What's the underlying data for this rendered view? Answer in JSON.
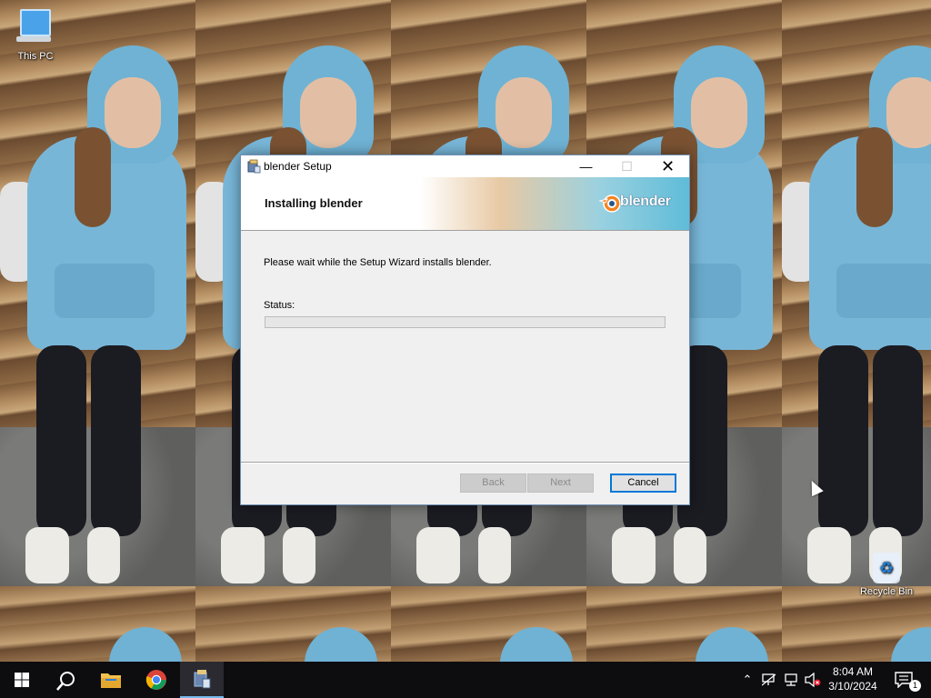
{
  "desktop": {
    "icons": [
      {
        "label": "This PC",
        "icon": "computer-icon"
      },
      {
        "label": "Recycle Bin",
        "icon": "recycle-bin-icon"
      }
    ]
  },
  "window": {
    "title": "blender Setup",
    "banner_title": "Installing blender",
    "logo_text": "blender",
    "wait_text": "Please wait while the Setup Wizard installs blender.",
    "status_label": "Status:",
    "progress_percent": 0,
    "buttons": {
      "back": "Back",
      "next": "Next",
      "cancel": "Cancel"
    },
    "controls": {
      "minimize": "minimize-icon",
      "maximize": "maximize-icon",
      "close": "close-icon"
    }
  },
  "taskbar": {
    "items": [
      "start-icon",
      "search-icon",
      "file-explorer-icon",
      "chrome-icon",
      "setup-installer-icon"
    ],
    "tray": [
      "chevron-up-icon",
      "network-icon",
      "network-icon",
      "volume-muted-icon"
    ],
    "time": "8:04 AM",
    "date": "3/10/2024",
    "notification_count": "1"
  },
  "colors": {
    "accent": "#0078d7",
    "taskbar": "#0d0d10",
    "active_indicator": "#76b9ed",
    "window_bg": "#f0f0f0"
  }
}
